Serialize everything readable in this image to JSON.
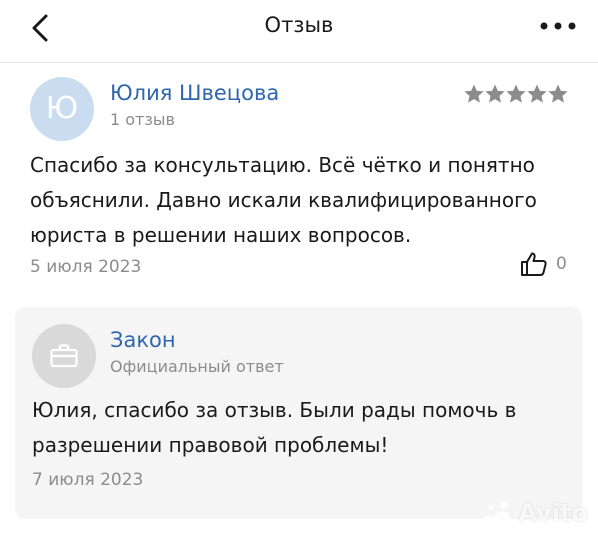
{
  "header": {
    "title": "Отзыв",
    "back_icon": "chevron-left-icon",
    "more_icon": "more-dots-icon"
  },
  "review": {
    "avatar_letter": "Ю",
    "author": "Юлия Швецова",
    "review_count": "1 отзыв",
    "rating": 5,
    "text": "Спасибо за консультацию. Всё чётко и понятно объяснили. Давно искали квалифицированного юриста в решении наших вопросов.",
    "date": "5 июля 2023",
    "likes": "0"
  },
  "reply": {
    "author": "Закон",
    "label": "Официальный ответ",
    "text": "Юлия, спасибо за отзыв. Были рады помочь в разрешении правовой проблемы!",
    "date": "7 июля 2023",
    "avatar_icon": "briefcase-icon"
  },
  "watermark": {
    "text": "Avito"
  },
  "colors": {
    "link": "#2f66ad",
    "star": "#8c8c8c",
    "muted": "#8c8c8c",
    "card_bg": "#f5f5f5"
  }
}
